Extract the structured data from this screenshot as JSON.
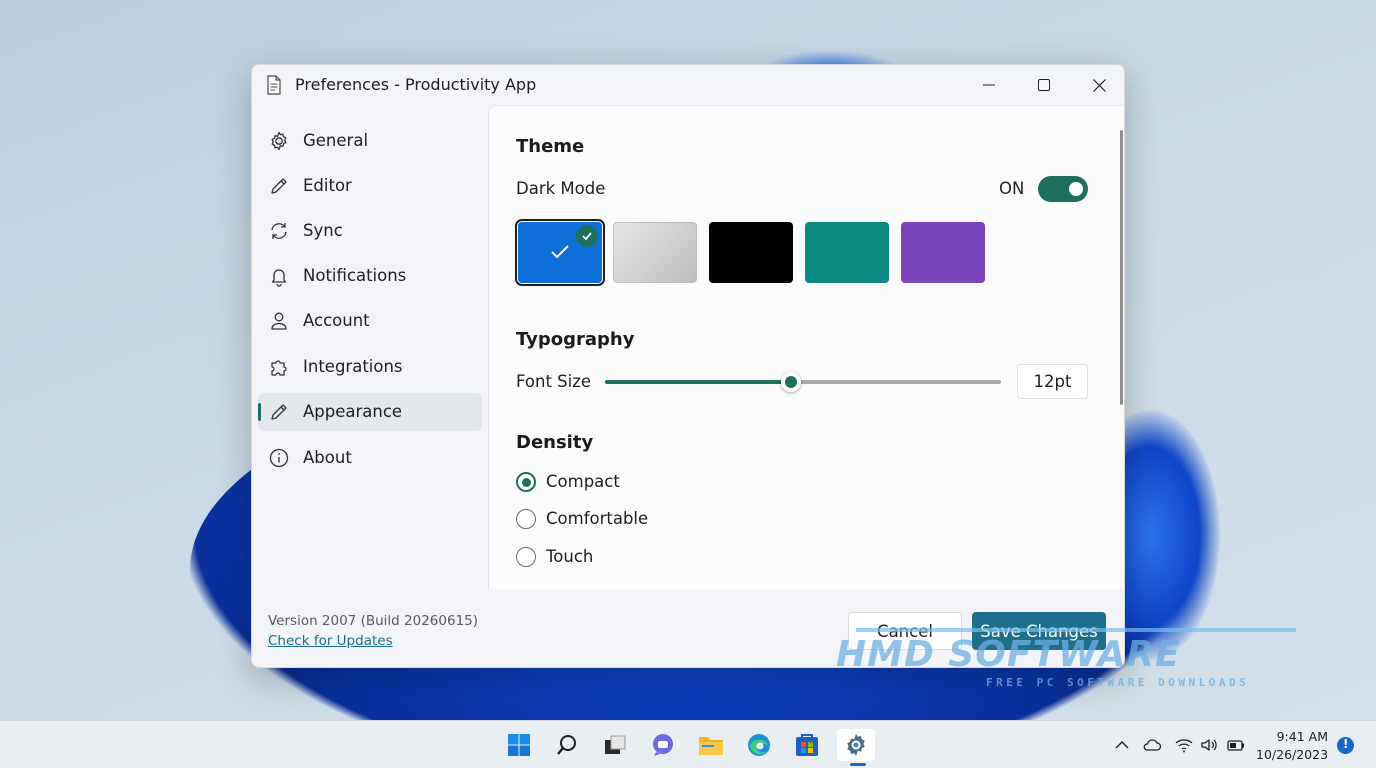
{
  "window": {
    "title": "Preferences - Productivity App"
  },
  "sidebar": {
    "items": [
      {
        "label": "General",
        "icon": "gear-icon"
      },
      {
        "label": "Editor",
        "icon": "pencil-icon"
      },
      {
        "label": "Sync",
        "icon": "sync-icon"
      },
      {
        "label": "Notifications",
        "icon": "bell-icon"
      },
      {
        "label": "Account",
        "icon": "user-icon"
      },
      {
        "label": "Integrations",
        "icon": "puzzle-icon"
      },
      {
        "label": "Appearance",
        "icon": "pencil-icon",
        "active": true
      },
      {
        "label": "About",
        "icon": "info-icon"
      }
    ],
    "version": "Version 2007 (Build 20260615)",
    "update_link": "Check for Updates"
  },
  "theme": {
    "heading": "Theme",
    "dark_mode_label": "Dark Mode",
    "dark_mode_state": "ON",
    "swatches": [
      {
        "color": "#0f6fd9",
        "selected": true
      },
      {
        "color": "#cfcfcf",
        "selected": false
      },
      {
        "color": "#000000",
        "selected": false
      },
      {
        "color": "#0c8a84",
        "selected": false
      },
      {
        "color": "#7d43b8",
        "selected": false
      }
    ]
  },
  "typography": {
    "heading": "Typography",
    "font_size_label": "Font Size",
    "font_size_value": "12pt",
    "slider_fraction": 0.47
  },
  "density": {
    "heading": "Density",
    "options": [
      {
        "label": "Compact",
        "selected": true
      },
      {
        "label": "Comfortable",
        "selected": false
      },
      {
        "label": "Touch",
        "selected": false
      }
    ]
  },
  "buttons": {
    "cancel": "Cancel",
    "save": "Save Changes"
  },
  "watermark": {
    "main": "HMD SOFTWARE",
    "sub": "FREE PC SOFTWARE DOWNLOADS"
  },
  "taskbar": {
    "time": "9:41 AM",
    "date": "10/26/2023"
  },
  "colors": {
    "accent": "#1e6f5c",
    "save_button": "#1e6f8c"
  }
}
